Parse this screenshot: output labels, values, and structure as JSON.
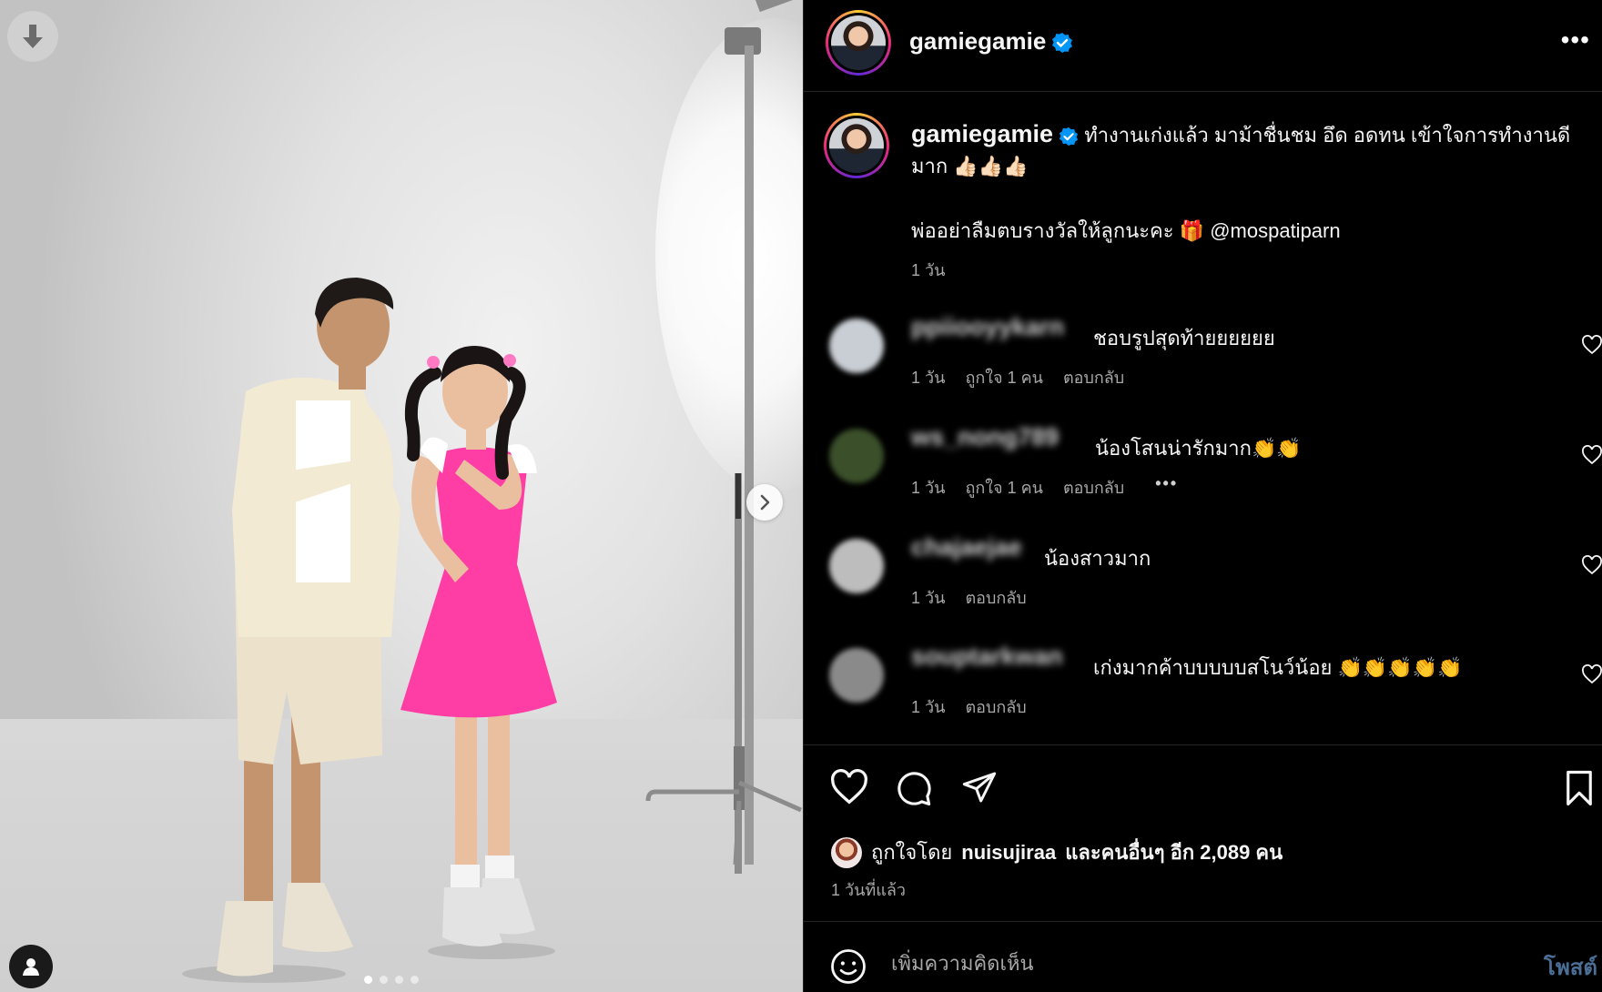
{
  "post": {
    "username": "gamiegamie",
    "more_icon": "more-horizontal-icon",
    "image_dots": {
      "count": 4,
      "active": 0
    }
  },
  "caption": {
    "username": "gamiegamie",
    "text": "ทำงานเก่งแล้ว มาม้าชื่นชม อึด อดทน เข้าใจการทำงานดีมาก 👍🏻👍🏻👍🏻",
    "line2": "พ่ออย่าลืมตบรางวัลให้ลูกนะคะ 🎁 @mospatiparn",
    "time": "1 วัน"
  },
  "comments": [
    {
      "username": "ppiiooyykarn",
      "text": "ชอบรูปสุดท้ายยยยยย",
      "time": "1 วัน",
      "likes": "ถูกใจ 1 คน",
      "reply": "ตอบกลับ",
      "more": "",
      "avatar_color": "#c9ced4"
    },
    {
      "username": "ws_nong789",
      "text": "น้องโสนน่ารักมาก👏👏",
      "time": "1 วัน",
      "likes": "ถูกใจ 1 คน",
      "reply": "ตอบกลับ",
      "more": "•••",
      "avatar_color": "#3b4f2a"
    },
    {
      "username": "chajaejae",
      "text": "น้องสาวมาก",
      "time": "1 วัน",
      "likes": "",
      "reply": "ตอบกลับ",
      "more": "",
      "avatar_color": "#bdbdbd"
    },
    {
      "username": "souptarkwan",
      "text": "เก่งมากค้าบบบบบสโนว์น้อย 👏👏👏👏👏",
      "time": "1 วัน",
      "likes": "",
      "reply": "ตอบกลับ",
      "more": "",
      "avatar_color": "#8a8a8a"
    }
  ],
  "actions": {
    "like_icon": "heart-icon",
    "comment_icon": "comment-icon",
    "share_icon": "send-icon",
    "save_icon": "bookmark-icon",
    "liked_by_prefix": "ถูกใจโดย",
    "liked_by_user": "nuisujiraa",
    "liked_by_suffix": "และคนอื่นๆ อีก 2,089 คน",
    "post_time": "1 วันที่แล้ว"
  },
  "comment_box": {
    "placeholder": "เพิ่มความคิดเห็น",
    "post_label": "โพสต์"
  },
  "colors": {
    "background": "#000000",
    "muted_text": "#a8a8a8",
    "verified": "#0095f6",
    "post_button": "#4a6e96",
    "dress": "#ff3ea5"
  }
}
